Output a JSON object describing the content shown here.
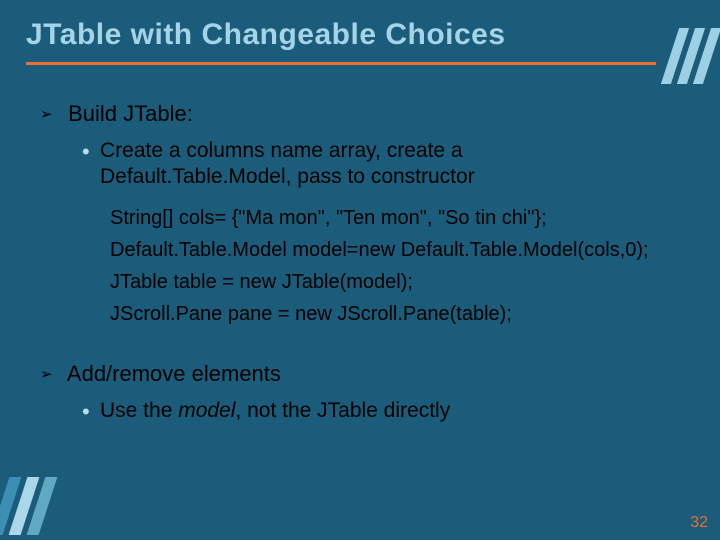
{
  "title": "JTable with Changeable Choices",
  "sections": [
    {
      "heading": "Build JTable:",
      "sub": "Create a columns name array, create  a Default.Table.Model, pass to constructor",
      "code": [
        "String[] cols= {\"Ma mon\", \"Ten mon\", \"So tin chi\"};",
        "Default.Table.Model model=new Default.Table.Model(cols,0);",
        "JTable table = new JTable(model);",
        " JScroll.Pane pane = new JScroll.Pane(table);"
      ]
    },
    {
      "heading": "Add/remove elements",
      "sub_parts": [
        "Use the ",
        "model",
        ", not the JTable directly"
      ]
    }
  ],
  "page_number": "32"
}
